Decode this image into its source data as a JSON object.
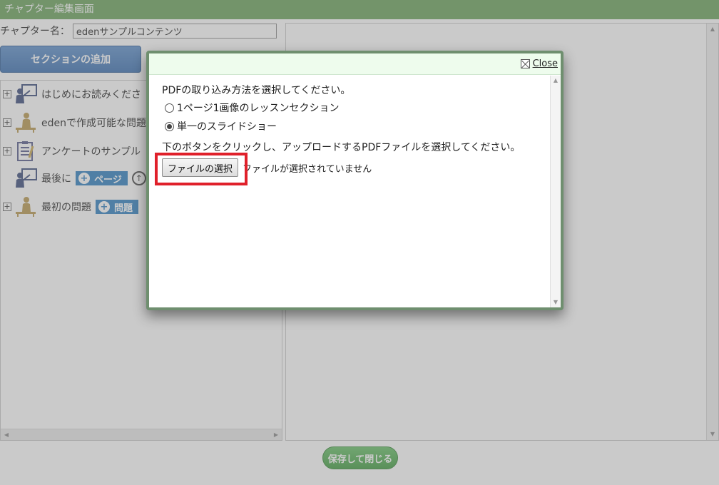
{
  "window": {
    "title": "チャプター編集画面"
  },
  "chapter": {
    "name_label": "チャプター名：",
    "name_value": "edenサンプルコンテンツ"
  },
  "toolbar": {
    "add_section_label": "セクションの追加"
  },
  "tree": {
    "items": [
      {
        "label": "はじめにお読みくださ",
        "expander": "+",
        "icon": "presentation-icon"
      },
      {
        "label": "edenで作成可能な問題例",
        "expander": "+",
        "icon": "learner-desk-icon"
      },
      {
        "label": "アンケートのサンプル",
        "expander": "+",
        "icon": "questionnaire-clipboard-icon"
      },
      {
        "label": "最後に",
        "icon": "presentation-icon",
        "pill": "ページ"
      },
      {
        "label": "最初の問題",
        "expander": "+",
        "icon": "learner-desk-icon",
        "pill": "問題"
      }
    ]
  },
  "footer": {
    "save_close_label": "保存して閉じる"
  },
  "dialog": {
    "close_label": "Close",
    "instruction": "PDFの取り込み方法を選択してください。",
    "options": [
      {
        "label": "1ページ1画像のレッスンセクション",
        "checked": false
      },
      {
        "label": "単一のスライドショー",
        "checked": true
      }
    ],
    "upload_instruction": "下のボタンをクリックし、アップロードするPDFファイルを選択してください。",
    "file_button_label": "ファイルの選択",
    "file_status": "ファイルが選択されていません"
  },
  "colors": {
    "titlebar": "#6aa35b",
    "section_button": "#3a6fb0",
    "pill": "#2d7fc0",
    "save_button": "#3f9c3f",
    "dialog_header": "#eefced",
    "highlight": "#e0202a"
  }
}
